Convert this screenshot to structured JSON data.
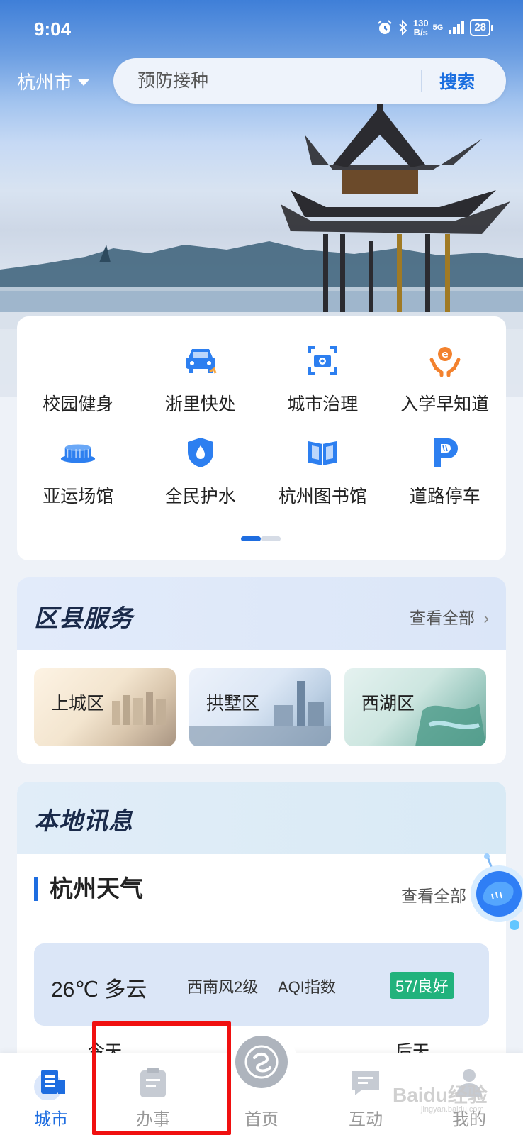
{
  "status_bar": {
    "time": "9:04",
    "net_speed_value": "130",
    "net_speed_unit": "B/s",
    "network": "5G",
    "battery": "28"
  },
  "header": {
    "city": "杭州市",
    "search_placeholder": "预防接种",
    "search_button": "搜索"
  },
  "apps": {
    "items": [
      {
        "label": "校园健身",
        "icon": "campus-fitness-icon"
      },
      {
        "label": "浙里快处",
        "icon": "car-accident-icon"
      },
      {
        "label": "城市治理",
        "icon": "camera-icon"
      },
      {
        "label": "入学早知道",
        "icon": "education-hands-icon"
      },
      {
        "label": "亚运场馆",
        "icon": "stadium-icon"
      },
      {
        "label": "全民护水",
        "icon": "water-shield-icon"
      },
      {
        "label": "杭州图书馆",
        "icon": "book-icon"
      },
      {
        "label": "道路停车",
        "icon": "parking-icon"
      }
    ],
    "page_indicator": {
      "current": 1,
      "total": 2
    }
  },
  "district": {
    "title": "区县服务",
    "view_all": "查看全部",
    "items": [
      "上城区",
      "拱墅区",
      "西湖区"
    ]
  },
  "news": {
    "title": "本地讯息",
    "weather_title": "杭州天气",
    "view_all": "查看全部",
    "weather": {
      "temp": "26℃ 多云",
      "wind": "西南风2级",
      "aqi_label": "AQI指数",
      "aqi_badge": "57/良好"
    },
    "partial_left": "今天",
    "partial_right": "后天"
  },
  "tabbar": {
    "tabs": [
      {
        "label": "城市",
        "active": true
      },
      {
        "label": "办事",
        "active": false
      },
      {
        "label": "首页",
        "active": false
      },
      {
        "label": "互动",
        "active": false
      },
      {
        "label": "我的",
        "active": false
      }
    ]
  },
  "watermark": "Baidu经验",
  "watermark_sub": "jingyan.baidu.com",
  "colors": {
    "accent": "#1e6de0",
    "aqi_good": "#21b27c",
    "highlight_box": "#f01010"
  }
}
